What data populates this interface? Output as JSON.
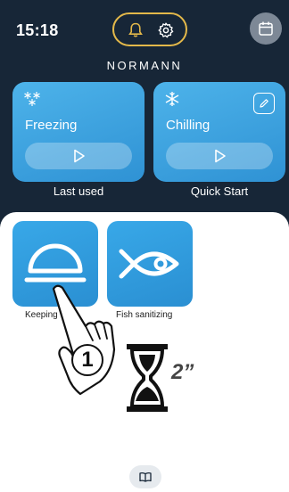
{
  "status": {
    "time": "15:18"
  },
  "header": {
    "brand": "NORMANN",
    "icons": {
      "bell": "bell-icon",
      "settings": "gear-icon",
      "calendar": "calendar-icon"
    },
    "accent_color": "#e3b84a"
  },
  "cards": [
    {
      "title": "Freezing",
      "caption": "Last used",
      "icon": "snowflakes-icon",
      "action": "play-icon"
    },
    {
      "title": "Chilling",
      "caption": "Quick Start",
      "icon": "snowflake-icon",
      "action": "play-icon",
      "edit": "edit-icon"
    }
  ],
  "programs": [
    {
      "label": "Keeping",
      "icon": "cloche-icon"
    },
    {
      "label": "Fish sanitizing",
      "icon": "fish-icon"
    }
  ],
  "instruction": {
    "step": "1",
    "duration": "2”"
  },
  "footer": {
    "icon": "book-icon"
  },
  "colors": {
    "header_bg": "#172637",
    "card_blue": "#3aa6e2",
    "white": "#ffffff"
  }
}
